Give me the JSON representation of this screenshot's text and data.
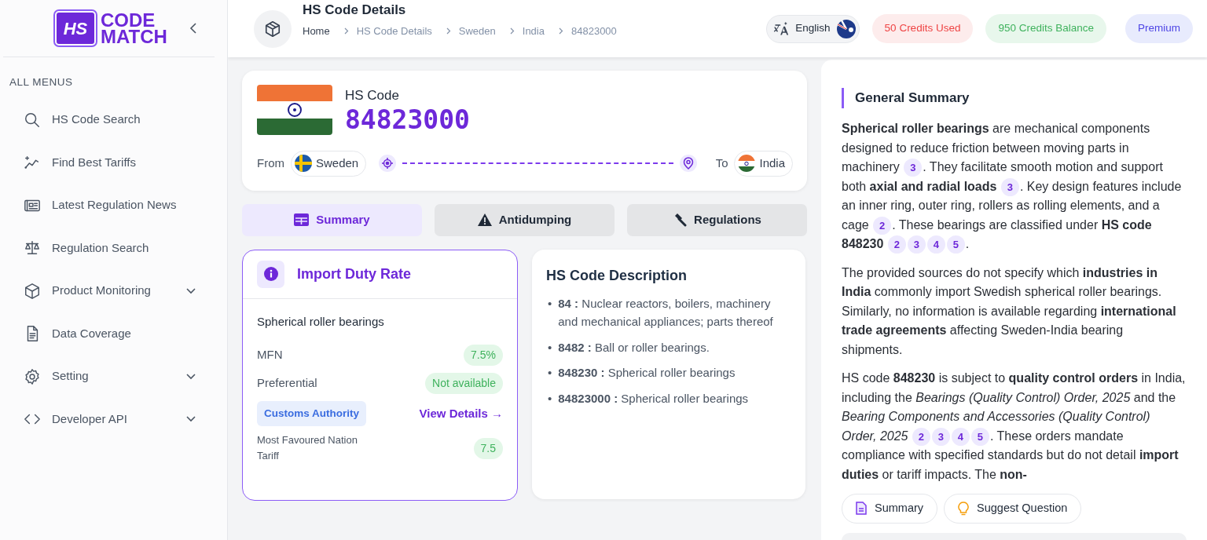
{
  "sidebar": {
    "logo": {
      "mark": "HS",
      "line_1": "CODE",
      "line_2": "MATCH"
    },
    "section_title": "ALL MENUS",
    "items": [
      {
        "label": "HS Code Search",
        "has_submenu": false,
        "selected": false
      },
      {
        "label": "Find Best Tariffs",
        "has_submenu": false,
        "selected": false
      },
      {
        "label": "Latest Regulation News",
        "has_submenu": false,
        "selected": false
      },
      {
        "label": "Regulation Search",
        "has_submenu": false,
        "selected": false
      },
      {
        "label": "Product Monitoring",
        "has_submenu": true,
        "selected": false
      },
      {
        "label": "Data Coverage",
        "has_submenu": false,
        "selected": false
      },
      {
        "label": "Setting",
        "has_submenu": true,
        "selected": false
      },
      {
        "label": "Developer API",
        "has_submenu": true,
        "selected": false
      }
    ]
  },
  "header": {
    "title": "HS Code Details",
    "breadcrumb": [
      "Home",
      "HS Code Details",
      "Sweden",
      "India",
      "84823000"
    ],
    "language": "English",
    "credits_used": "50 Credits Used",
    "credits_balance": "950 Credits Balance",
    "plan": "Premium"
  },
  "hs_card": {
    "label": "HS Code",
    "code": "84823000",
    "from_label": "From",
    "from_country": "Sweden",
    "to_label": "To",
    "to_country": "India"
  },
  "tabs": [
    {
      "label": "Summary",
      "selected": true
    },
    {
      "label": "Antidumping",
      "selected": false
    },
    {
      "label": "Regulations",
      "selected": false
    }
  ],
  "duty_card": {
    "title": "Import Duty Rate",
    "product": "Spherical roller bearings",
    "rates": [
      {
        "label": "MFN",
        "value": "7.5%"
      },
      {
        "label": "Preferential",
        "value": "Not available"
      }
    ],
    "authority": "Customs Authority",
    "link": "View Details →",
    "tariff_label": "Most Favoured Nation Tariff",
    "tariff_value": "7.5"
  },
  "description": {
    "title": "HS Code Description",
    "items": [
      {
        "marker": "•",
        "text": "**84 :** Nuclear reactors, boilers, machinery and mechanical appliances; parts thereof"
      },
      {
        "marker": "•",
        "text": "**8482 :** Ball or roller bearings."
      },
      {
        "marker": "•",
        "text": "**848230 :** Spherical roller bearings"
      },
      {
        "marker": "•",
        "text": "**84823000 :** Spherical roller bearings"
      }
    ]
  },
  "summary": {
    "title": "General Summary",
    "paragraphs": [
      [
        {
          "text": "**Spherical roller bearings** are mechanical components designed to reduce friction between moving parts in machinery "
        },
        {
          "cite": "3"
        },
        {
          "text": ". They facilitate smooth motion and support both **axial and radial loads** "
        },
        {
          "cite": "3"
        },
        {
          "text": ". Key design features include an inner ring, outer ring, rollers as rolling elements, and a cage "
        },
        {
          "cite": "2"
        },
        {
          "text": ". These bearings are classified under **HS code 848230** "
        },
        {
          "cite": "2"
        },
        {
          "cite": "3"
        },
        {
          "cite": "4"
        },
        {
          "cite": "5"
        },
        {
          "text": "."
        }
      ],
      [
        {
          "text": "The provided sources do not specify which **industries in India** commonly import Swedish spherical roller bearings. Similarly, no information is available regarding **international trade agreements** affecting Sweden-India bearing shipments."
        }
      ],
      [
        {
          "text": "HS code **848230** is subject to **quality control orders** in India, including the *Bearings (Quality Control) Order, 2025* and the *Bearing Components and Accessories (Quality Control) Order, 2025* "
        },
        {
          "cite": "2"
        },
        {
          "cite": "3"
        },
        {
          "cite": "4"
        },
        {
          "cite": "5"
        },
        {
          "text": ". These orders mandate compliance with specified standards but do not detail **import duties** or tariff impacts. The **non-**"
        }
      ]
    ],
    "actions": [
      "Summary",
      "Suggest Question"
    ]
  }
}
